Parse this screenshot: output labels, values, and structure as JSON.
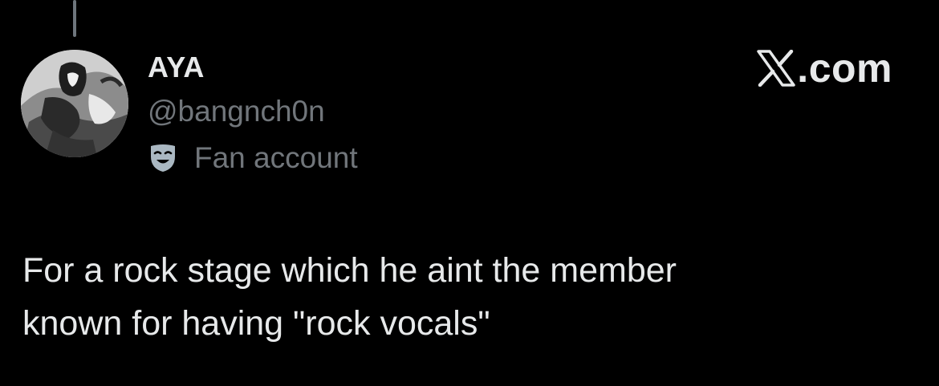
{
  "post": {
    "author": {
      "display_name": "AYA",
      "handle": "@bangnch0n",
      "label_icon": "theater-mask-icon",
      "label_text": "Fan account"
    },
    "text_lines": [
      "For a rock stage which he aint the member",
      "known for having \"rock vocals\""
    ]
  },
  "brand": {
    "logo_icon": "x-logo-icon",
    "suffix": ".com"
  },
  "colors": {
    "background": "#000000",
    "primary_text": "#e7e9ea",
    "secondary_text": "#71767b",
    "thread_line": "#6e767d",
    "label_icon": "#aab8c2"
  }
}
